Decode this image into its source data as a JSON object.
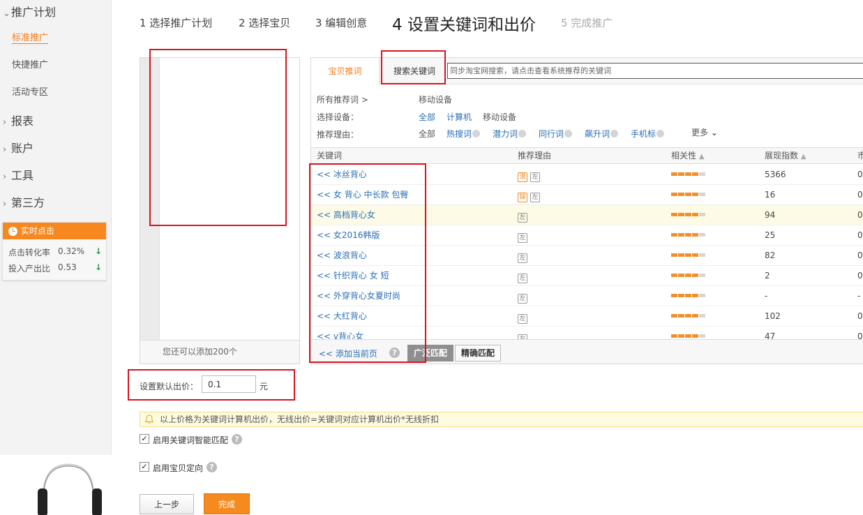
{
  "sidebar": {
    "plan_header": "推广计划",
    "sub_items": [
      "标准推广",
      "快捷推广",
      "活动专区"
    ],
    "sections": [
      "报表",
      "账户",
      "工具",
      "第三方"
    ],
    "realtime": {
      "title": "实时点击",
      "rows": [
        {
          "label": "点击转化率",
          "value": "0.32%"
        },
        {
          "label": "投入产出比",
          "value": "0.53"
        }
      ]
    }
  },
  "steps": [
    {
      "label": "1 选择推广计划"
    },
    {
      "label": "2 选择宝贝"
    },
    {
      "label": "3 编辑创意"
    },
    {
      "label": "4 设置关键词和出价"
    },
    {
      "label": "5 完成推广"
    }
  ],
  "left_panel": {
    "footer": "您还可以添加200个"
  },
  "right_panel": {
    "tabs": [
      "宝贝推词",
      "搜索关键词"
    ],
    "search_placeholder": "同步淘宝网搜索，请点击查看系统推荐的关键词",
    "filters": {
      "all_label": "所有推荐词 >",
      "all_value": "移动设备",
      "device_label": "选择设备：",
      "devices": [
        "全部",
        "计算机",
        "移动设备"
      ],
      "reason_label": "推荐理由：",
      "reasons": [
        "全部",
        "热搜词",
        "潜力词",
        "同行词",
        "飙升词",
        "手机标"
      ],
      "more": "更多"
    },
    "columns": [
      "关键词",
      "推荐理由",
      "相关性",
      "展现指数",
      "市"
    ],
    "rows": [
      {
        "keyword": "<< 冰丝背心",
        "tags": [
          "潜",
          "左"
        ],
        "relevance": 0.8,
        "index": "5366",
        "col5": "0"
      },
      {
        "keyword": "<< 女 背心 中长款 包臀",
        "tags": [
          "锦",
          "左"
        ],
        "relevance": 0.8,
        "index": "16",
        "col5": "0"
      },
      {
        "keyword": "<< 高档背心女",
        "tags": [
          "左"
        ],
        "relevance": 0.8,
        "index": "94",
        "col5": "0"
      },
      {
        "keyword": "<< 女2016韩版",
        "tags": [
          "左"
        ],
        "relevance": 0.8,
        "index": "25",
        "col5": "0"
      },
      {
        "keyword": "<< 波浪背心",
        "tags": [
          "左"
        ],
        "relevance": 0.8,
        "index": "82",
        "col5": "0"
      },
      {
        "keyword": "<< 针织背心 女 短",
        "tags": [
          "左"
        ],
        "relevance": 0.8,
        "index": "2",
        "col5": "0"
      },
      {
        "keyword": "<< 外穿背心女夏时尚",
        "tags": [
          "左"
        ],
        "relevance": 0.8,
        "index": "-",
        "col5": "-"
      },
      {
        "keyword": "<< 大红背心",
        "tags": [
          "左"
        ],
        "relevance": 0.8,
        "index": "102",
        "col5": "0"
      },
      {
        "keyword": "<< v背心女",
        "tags": [
          "左"
        ],
        "relevance": 0.8,
        "index": "47",
        "col5": "0"
      }
    ],
    "footer": {
      "add_label": "<< 添加当前页",
      "match_broad": "广泛匹配",
      "match_exact": "精确匹配"
    }
  },
  "price": {
    "label": "设置默认出价：",
    "value": "0.1",
    "unit": "元"
  },
  "notice": "以上价格为关键词计算机出价，无线出价=关键词对应计算机出价*无线折扣",
  "options": [
    {
      "label": "启用关键词智能匹配",
      "checked": true
    },
    {
      "label": "启用宝贝定向",
      "checked": true
    }
  ],
  "buttons": {
    "prev": "上一步",
    "done": "完成"
  },
  "colors": {
    "accent": "#f37b1d",
    "link": "#2a6fb5",
    "annotation": "#d9121f"
  }
}
